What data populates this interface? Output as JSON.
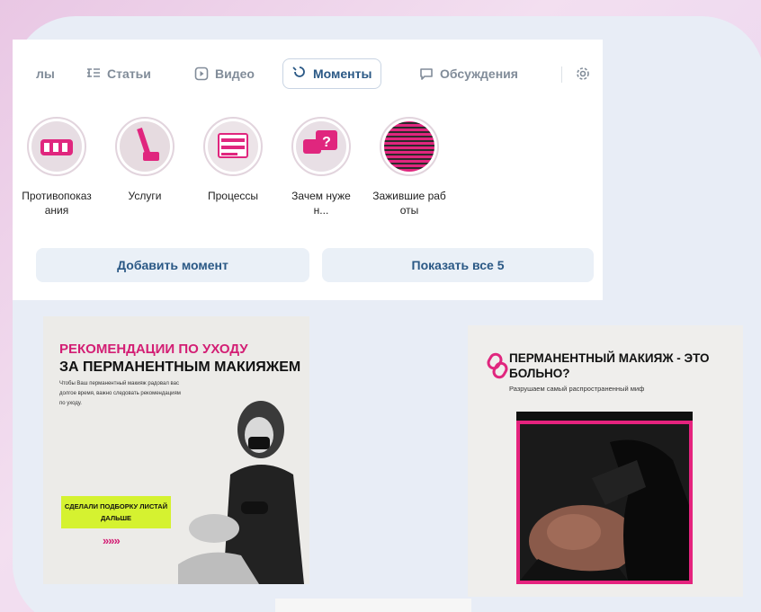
{
  "tabs": [
    {
      "label": "лы",
      "icon": "clips-icon"
    },
    {
      "label": "Статьи",
      "icon": "articles-icon"
    },
    {
      "label": "Видео",
      "icon": "video-icon"
    },
    {
      "label": "Моменты",
      "icon": "moments-icon",
      "active": true
    },
    {
      "label": "Обсуждения",
      "icon": "discussions-icon"
    }
  ],
  "settings_icon": "gear-icon",
  "stories": [
    {
      "label": "Противопоказания",
      "icon": "contraindications-icon"
    },
    {
      "label": "Услуги",
      "icon": "services-icon"
    },
    {
      "label": "Процессы",
      "icon": "processes-icon"
    },
    {
      "label": "Зачем нужен...",
      "icon": "why-icon"
    },
    {
      "label": "Зажившие работы",
      "icon": "healed-works-icon"
    }
  ],
  "buttons": {
    "add_moment": "Добавить момент",
    "show_all": "Показать все 5"
  },
  "post1": {
    "title_line1": "РЕКОМЕНДАЦИИ ПО УХОДУ",
    "title_line2": "ЗА ПЕРМАНЕНТНЫМ МАКИЯЖЕМ",
    "body": "Чтобы Ваш перманентный макияж радовал вас долгое время, важно следовать рекомендациям по уходу.",
    "badge": "СДЕЛАЛИ ПОДБОРКУ ЛИСТАЙ ДАЛЬШЕ",
    "arrows": "»»»"
  },
  "post2": {
    "title": "ПЕРМАНЕНТНЫЙ МАКИЯЖ - ЭТО БОЛЬНО?",
    "subtitle": "Разрушаем самый распространенный миф"
  },
  "colors": {
    "accent": "#2a5885",
    "pink": "#d31e74",
    "lime": "#d5f230",
    "frame": "#e8edf6"
  }
}
